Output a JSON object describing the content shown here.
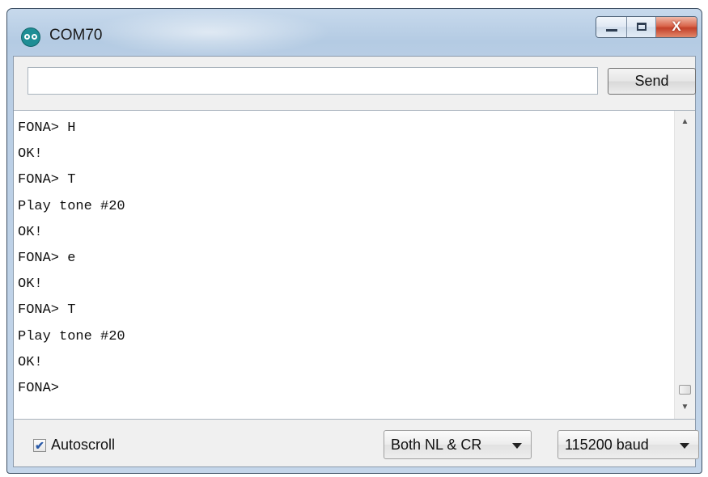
{
  "window": {
    "title": "COM70",
    "minimize_icon": "minimize-icon",
    "maximize_icon": "maximize-icon",
    "close_glyph": "X"
  },
  "input_bar": {
    "value": "",
    "placeholder": "",
    "send_label": "Send"
  },
  "console": {
    "lines": [
      "FONA> H",
      "OK!",
      "FONA> T",
      "Play tone #20",
      "OK!",
      "FONA> e",
      "OK!",
      "FONA> T",
      "Play tone #20",
      "OK!",
      "FONA>"
    ],
    "scroll_up_icon": "scroll-up-arrow-icon",
    "scroll_down_icon": "scroll-down-arrow-icon"
  },
  "footer": {
    "autoscroll_label": "Autoscroll",
    "autoscroll_checked": true,
    "check_glyph": "✔",
    "line_ending": "Both NL & CR",
    "baud_rate": "115200 baud"
  },
  "colors": {
    "title_bar": "#b4cbe3",
    "close_button": "#c3412a",
    "app_icon": "#1f8e95"
  }
}
